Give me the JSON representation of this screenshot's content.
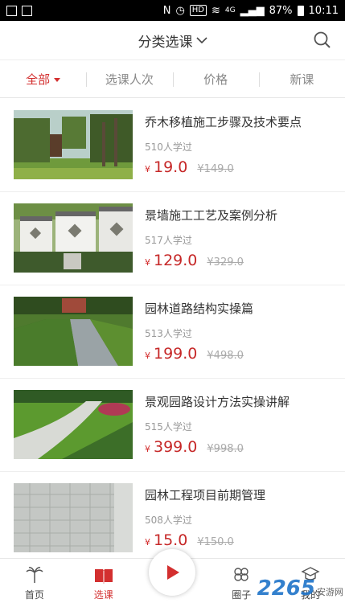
{
  "status_bar": {
    "signal": "4G",
    "battery": "87%",
    "time": "10:11",
    "hd": "HD"
  },
  "header": {
    "title": "分类选课"
  },
  "filters": [
    {
      "label": "全部"
    },
    {
      "label": "选课人次"
    },
    {
      "label": "价格"
    },
    {
      "label": "新课"
    }
  ],
  "courses": [
    {
      "title": "乔木移植施工步骤及技术要点",
      "learners": "510人学过",
      "currency": "¥",
      "price": "19.0",
      "original_price": "¥149.0"
    },
    {
      "title": "景墙施工工艺及案例分析",
      "learners": "517人学过",
      "currency": "¥",
      "price": "129.0",
      "original_price": "¥329.0"
    },
    {
      "title": "园林道路结构实操篇",
      "learners": "513人学过",
      "currency": "¥",
      "price": "199.0",
      "original_price": "¥498.0"
    },
    {
      "title": "景观园路设计方法实操讲解",
      "learners": "515人学过",
      "currency": "¥",
      "price": "399.0",
      "original_price": "¥998.0"
    },
    {
      "title": "园林工程项目前期管理",
      "learners": "508人学过",
      "currency": "¥",
      "price": "15.0",
      "original_price": "¥150.0"
    }
  ],
  "tabbar": [
    {
      "label": "首页"
    },
    {
      "label": "选课"
    },
    {
      "label": "圈子"
    },
    {
      "label": "我的"
    }
  ],
  "watermark": {
    "number": "2265",
    "text": "安游网"
  },
  "colors": {
    "accent": "#d32f2f",
    "text": "#333333",
    "muted": "#999999"
  }
}
